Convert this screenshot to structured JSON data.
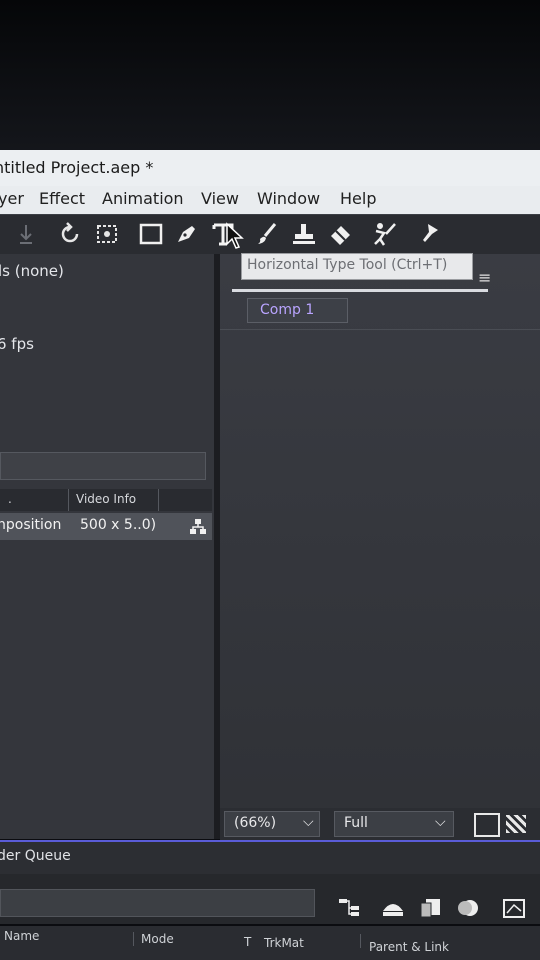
{
  "window": {
    "title": "ntitled Project.aep *"
  },
  "menu": {
    "items": [
      "yer",
      "Effect",
      "Animation",
      "View",
      "Window",
      "Help"
    ]
  },
  "toolbar": {
    "tools": [
      "arrow-down-icon",
      "rotate-icon",
      "camera-behind-icon",
      "rectangle-icon",
      "pen-icon",
      "type-icon",
      "brush-icon",
      "clone-stamp-icon",
      "eraser-icon",
      "roto-brush-icon",
      "puppet-pin-icon"
    ],
    "tooltip": "Horizontal Type Tool (Ctrl+T)"
  },
  "project_panel": {
    "info_line1": "ls (none)",
    "info_line2": "6 fps",
    "column_header_video": "Video Info",
    "column_header_dot": ".",
    "item_name": "nposition",
    "item_video_info": "500 x 5..0)"
  },
  "composition_panel": {
    "tab_label": "Comp 1",
    "zoom": "(66%)",
    "resolution": "Full"
  },
  "timeline": {
    "tab_label": "der Queue",
    "columns": [
      "Name",
      "Mode",
      "T",
      "TrkMat",
      "Parent & Link"
    ]
  },
  "colors": {
    "accent": "#5a5cd8",
    "comp_tab_text": "#b9a4ff",
    "menu_bg": "#e9ecef",
    "panel_bg": "#34363c"
  }
}
